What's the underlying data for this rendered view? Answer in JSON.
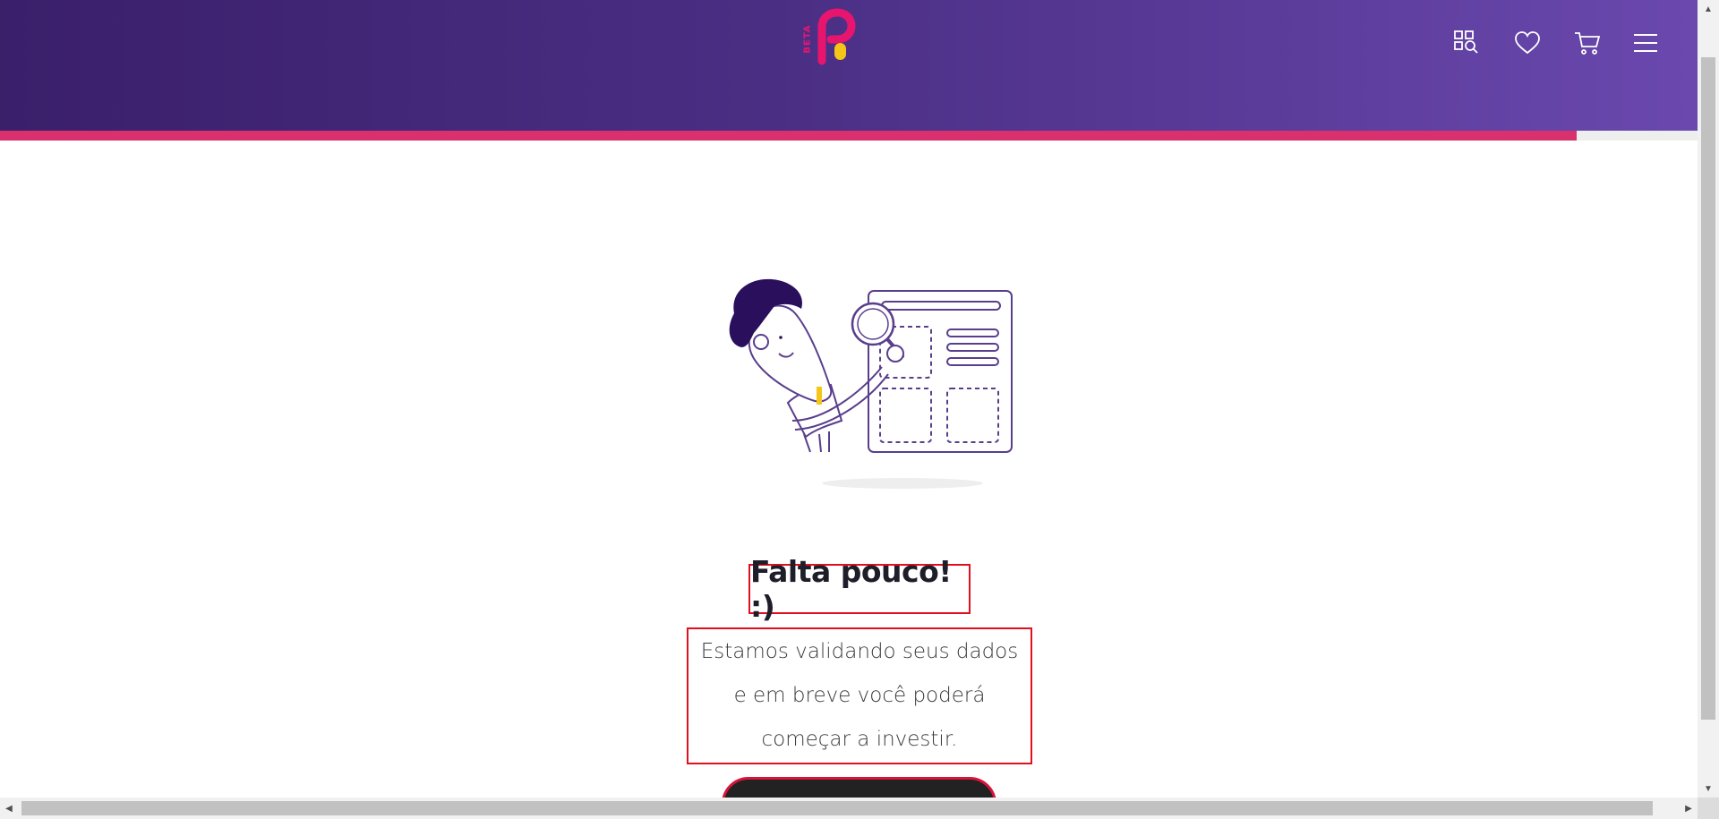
{
  "header": {
    "logo_badge": "BETA",
    "brand_colors": {
      "pink": "#e8156f",
      "yellow": "#f5c518",
      "gradient_start": "#3a1f6b",
      "gradient_end": "#6a48ae"
    },
    "icons": [
      "search-catalog-icon",
      "heart-icon",
      "cart-icon",
      "menu-icon"
    ]
  },
  "progress": {
    "percent": 92.9,
    "color": "#d9306e"
  },
  "main": {
    "title": "Falta pouco! :)",
    "description": "Estamos validando seus dados e em breve você poderá começar a investir."
  }
}
